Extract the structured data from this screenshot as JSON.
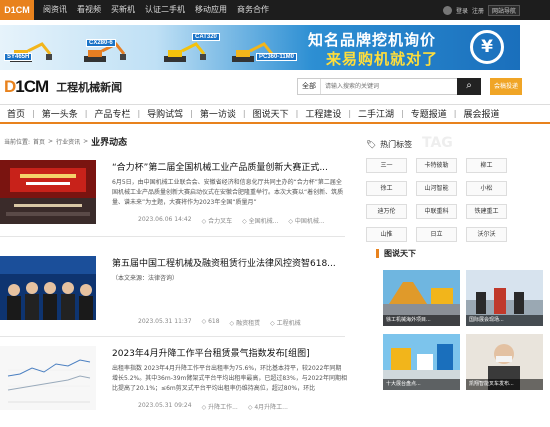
{
  "topbar": {
    "logo": "D1CM",
    "nav": [
      "阅资讯",
      "看视频",
      "买新机",
      "认证二手机",
      "移动应用",
      "商务合作"
    ],
    "login": "登录",
    "register": "注册",
    "select": "网站导航"
  },
  "banner": {
    "tags": [
      "SY465H",
      "CX280-6",
      "CAT320",
      "PC360-11M0"
    ],
    "slogan_line1": "知名品牌挖机询价",
    "slogan_line2": "来易购机就对了",
    "icon": "yen-icon"
  },
  "header": {
    "logo_text": "D1CM",
    "site_name": "工程机械新闻",
    "search_scope": "全部",
    "search_placeholder": "请输入搜索的关键词",
    "submit_label": "会稿投递"
  },
  "mainnav": [
    "首页",
    "第一头条",
    "产品专栏",
    "导购试驾",
    "第一访谈",
    "图说天下",
    "工程建设",
    "二手江湖",
    "专题报道",
    "展会报道"
  ],
  "breadcrumb": {
    "label": "当前位置:",
    "items": [
      "首页",
      "行业资讯"
    ],
    "current": "业界动态"
  },
  "articles": [
    {
      "title": "“合力杯”第二届全国机械工业产品质量创新大赛正式...",
      "summary": "6月5日，由中国机械工业联合会、安徽省经济和信息化厅共同主办的“合力杯”第二届全国机械工业产品质量创新大赛启动仪式在安徽合肥隆重举行。本次大赛以“着创新、筑质量、谱未来”为主题，大赛将作为2023年全国“质量月”",
      "date": "2023.06.06 14:42",
      "tags": [
        "合力叉车",
        "全国机械...",
        "中国机械..."
      ]
    },
    {
      "title": "第五届中国工程机械及融资租赁行业法律风控资智618...",
      "summary": "（本文来源：法律咨询）",
      "date": "2023.05.31 11:37",
      "tags": [
        "618",
        "融资租赁",
        "工程机械"
      ]
    },
    {
      "title": "2023年4月升降工作平台租赁景气指数发布[组图]",
      "summary": "出租率指数 2023年4月升降工作平台出租率为75.6%，环比基本持平，较2022年同期增长5.2%。其中36m-39m臂架式平台平均出租率最高，已超过83%，与2022年同期相比提高了20.1%；≤6m剪叉式平台平均出租率仍维持高位，超过80%，环比",
      "date": "2023.05.31 09:24",
      "tags": [
        "升降工作...",
        "4月升降工..."
      ]
    }
  ],
  "sidebar": {
    "hot_tags_title": "热门标签",
    "hot_tags_ghost": "TAG",
    "tags": [
      "三一",
      "卡特彼勒",
      "柳工",
      "徐工",
      "山河智能",
      "小松",
      "迪万伦",
      "中联重科",
      "铁建重工",
      "山推",
      "日立",
      "沃尔沃"
    ],
    "pictures_title": "图说天下",
    "pictures": [
      "徐工机械海外项目...",
      "国际展会现场...",
      "十大展台盘点...",
      "凯翔智能叉车发布..."
    ]
  },
  "colors": {
    "accent": "#e8821d",
    "topbar": "#1d1d1d",
    "banner_blue": "#1a6fbc",
    "submit": "#f0a526"
  }
}
